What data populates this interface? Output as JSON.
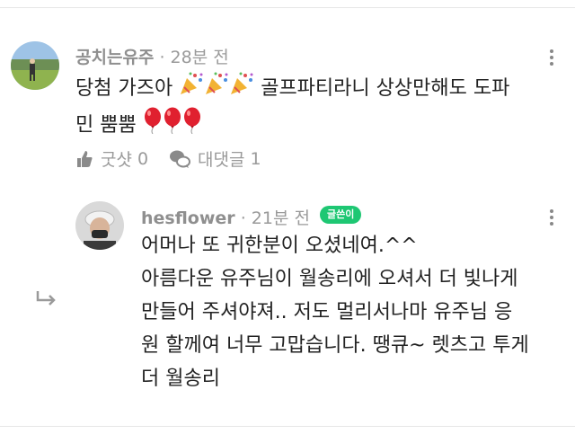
{
  "comment": {
    "author": "공치는유주",
    "time": "28분 전",
    "line1": "당첨 가즈아",
    "line1b": "골프파티라니 상상만해도 도파",
    "line2": "민 뿜뿜",
    "like_label": "굿샷",
    "like_count": "0",
    "reply_label": "대댓글",
    "reply_count": "1",
    "icons": [
      "party-popper-icon",
      "balloon-icon",
      "thumbs-up-icon",
      "chat-bubble-icon",
      "more-vertical-icon"
    ]
  },
  "reply": {
    "author": "hesflower",
    "time": "21분 전",
    "badge": "글쓴이",
    "lines": [
      "어머나 또 귀한분이 오셨네여.^^",
      "아름다운 유주님이 월송리에 오셔서 더 빛나게",
      "만들어 주셔야져.. 저도 멀리서나마 유주님 응",
      "원 할께여 너무 고맙습니다. 땡큐~ 렛츠고 투게",
      "더 월송리"
    ],
    "icons": [
      "reply-arrow-icon",
      "more-vertical-icon"
    ]
  },
  "colors": {
    "badge": "#1ec773",
    "meta": "#9a9a9a",
    "text": "#222222"
  }
}
